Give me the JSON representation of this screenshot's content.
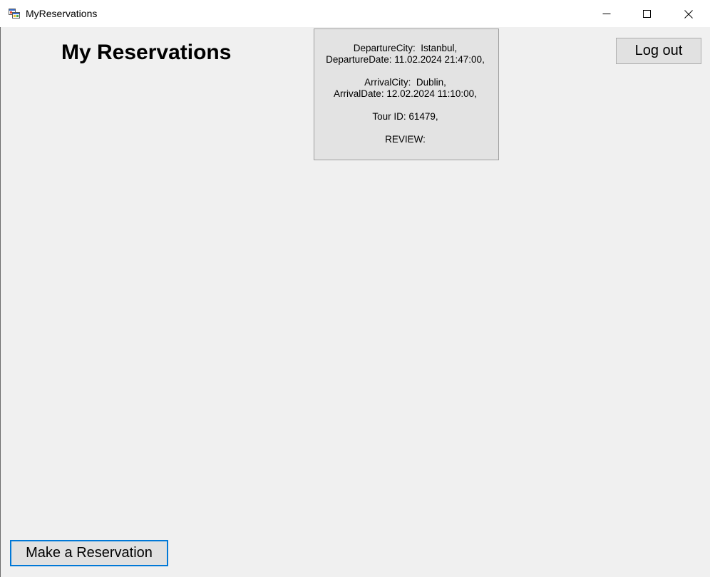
{
  "window": {
    "title": "MyReservations",
    "icons": {
      "app": "app-icon",
      "minimize": "minimize-icon",
      "maximize": "maximize-icon",
      "close": "close-icon"
    }
  },
  "header": {
    "title": "My Reservations"
  },
  "reservations": [
    {
      "departure_city": "DepartureCity:  Istanbul,",
      "departure_date": "DepartureDate: 11.02.2024 21:47:00,",
      "arrival_city": "ArrivalCity:  Dublin,",
      "arrival_date": "ArrivalDate: 12.02.2024 11:10:00,",
      "tour_id": "Tour ID: 61479,",
      "review": "REVIEW:"
    }
  ],
  "buttons": {
    "logout_label": "Log out",
    "make_reservation_label": "Make a Reservation"
  },
  "colors": {
    "window_background": "#F0F0F0",
    "title_bar": "#FFFFFF",
    "card_background": "#E3E3E3",
    "button_face": "#E1E1E1",
    "button_border": "#ADADAD",
    "accent": "#0078D7"
  }
}
